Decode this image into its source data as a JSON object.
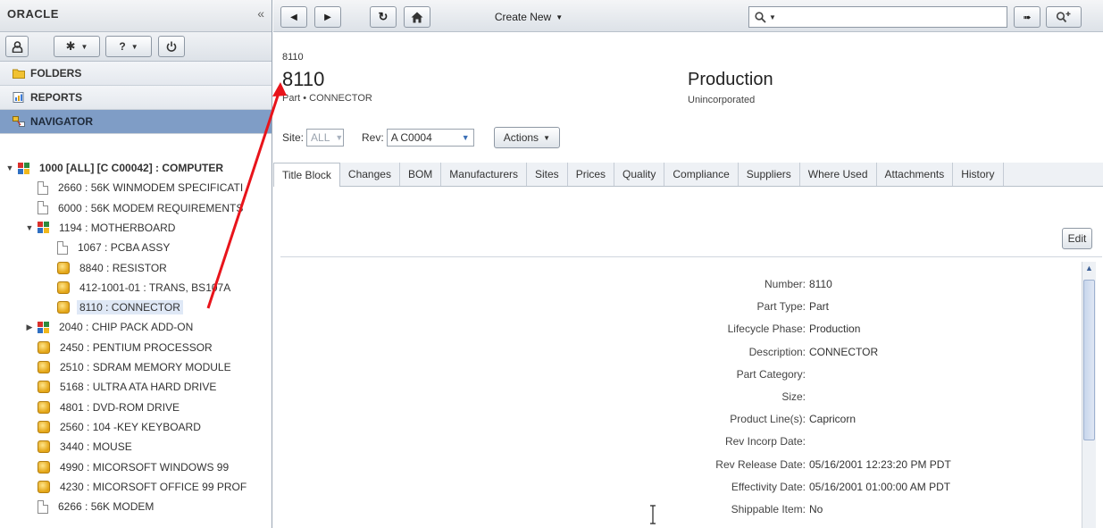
{
  "left": {
    "logo": "ORACLE",
    "collapse_icon": "«",
    "toolbar": {
      "user_icon": "user-icon",
      "gear_icon": "gear-icon",
      "help": "?",
      "power_icon": "power-icon"
    },
    "sections": [
      {
        "label": "FOLDERS",
        "icon": "folder-icon"
      },
      {
        "label": "REPORTS",
        "icon": "report-icon"
      },
      {
        "label": "NAVIGATOR",
        "icon": "navigator-icon",
        "active": true
      }
    ],
    "tree": [
      {
        "label": "1000 [ALL] [C C00042] : COMPUTER",
        "type": "assembly",
        "level": 0,
        "expanded": true
      },
      {
        "label": "2660 : 56K WINMODEM SPECIFICATI",
        "type": "document",
        "level": 1
      },
      {
        "label": "6000 : 56K MODEM REQUIREMENTS",
        "type": "document",
        "level": 1
      },
      {
        "label": "1194 : MOTHERBOARD",
        "type": "assembly",
        "level": 1,
        "expanded": true
      },
      {
        "label": "1067 : PCBA ASSY",
        "type": "document",
        "level": 2
      },
      {
        "label": "8840 : RESISTOR",
        "type": "part",
        "level": 2
      },
      {
        "label": "412-1001-01 : TRANS, BS107A",
        "type": "part",
        "level": 2
      },
      {
        "label": "8110 : CONNECTOR",
        "type": "part",
        "level": 2,
        "selected": true
      },
      {
        "label": "2040 : CHIP PACK ADD-ON",
        "type": "assembly",
        "level": 1,
        "expanded": false
      },
      {
        "label": "2450 : PENTIUM PROCESSOR",
        "type": "part",
        "level": 1
      },
      {
        "label": "2510 : SDRAM MEMORY MODULE",
        "type": "part",
        "level": 1
      },
      {
        "label": "5168 : ULTRA ATA HARD DRIVE",
        "type": "part",
        "level": 1
      },
      {
        "label": "4801 : DVD-ROM DRIVE",
        "type": "part",
        "level": 1
      },
      {
        "label": "2560 : 104 -KEY KEYBOARD",
        "type": "part",
        "level": 1
      },
      {
        "label": "3440 : MOUSE",
        "type": "part",
        "level": 1
      },
      {
        "label": "4990 : MICORSOFT WINDOWS 99",
        "type": "part",
        "level": 1
      },
      {
        "label": "4230 : MICORSOFT OFFICE 99 PROF",
        "type": "part",
        "level": 1
      },
      {
        "label": "6266 : 56K MODEM",
        "type": "document",
        "level": 1
      }
    ]
  },
  "topbar": {
    "back_icon": "back-icon",
    "forward_icon": "forward-icon",
    "refresh_icon": "refresh-icon",
    "home_icon": "home-icon",
    "create_new": "Create New",
    "search_placeholder": "",
    "search_icon": "search-icon",
    "quick_access_icon": "quick-access-icon",
    "advanced_search_icon": "advanced-search-icon"
  },
  "object": {
    "number_small": "8110",
    "number": "8110",
    "subtitle": "Part • CONNECTOR",
    "lifecycle": "Production",
    "incorporation": "Unincorporated",
    "site_label": "Site:",
    "site_value": "ALL",
    "rev_label": "Rev:",
    "rev_value": "A C0004",
    "actions": "Actions"
  },
  "tabs": [
    "Title Block",
    "Changes",
    "BOM",
    "Manufacturers",
    "Sites",
    "Prices",
    "Quality",
    "Compliance",
    "Suppliers",
    "Where Used",
    "Attachments",
    "History"
  ],
  "active_tab": "Title Block",
  "edit_label": "Edit",
  "fields": [
    {
      "label": "Number:",
      "value": "8110"
    },
    {
      "label": "Part Type:",
      "value": "Part"
    },
    {
      "label": "Lifecycle Phase:",
      "value": "Production"
    },
    {
      "label": "Description:",
      "value": "CONNECTOR"
    },
    {
      "label": "Part Category:",
      "value": ""
    },
    {
      "label": "Size:",
      "value": ""
    },
    {
      "label": "Product Line(s):",
      "value": "Capricorn"
    },
    {
      "label": "Rev Incorp Date:",
      "value": ""
    },
    {
      "label": "Rev Release Date:",
      "value": "05/16/2001 12:23:20 PM PDT"
    },
    {
      "label": "Effectivity Date:",
      "value": "05/16/2001 01:00:00 AM PDT"
    },
    {
      "label": "Shippable Item:",
      "value": "No"
    }
  ],
  "colors": {
    "annotation_arrow": "#e8141b",
    "navigator_active": "#7f9dc6",
    "selected_row": "#dfe8f6"
  }
}
